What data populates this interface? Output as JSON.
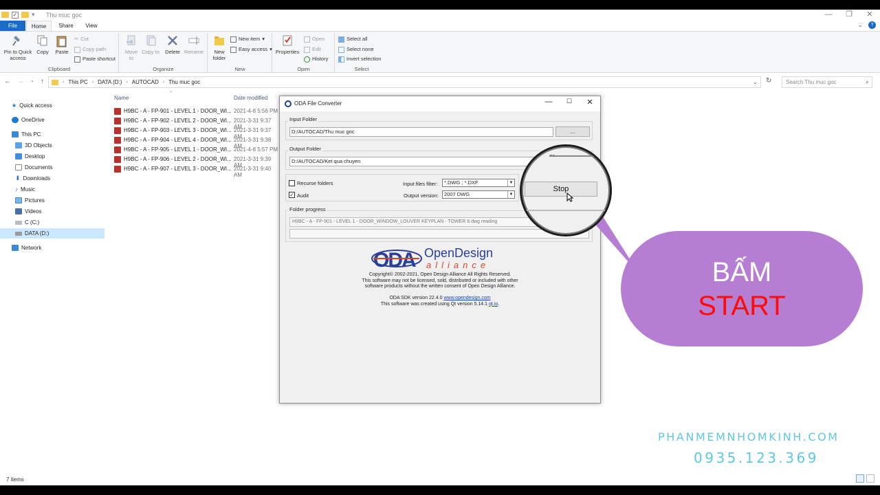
{
  "window": {
    "title": "Thu muc goc",
    "min": "—",
    "max": "❐",
    "close": "✕"
  },
  "ribbon_tabs": [
    "File",
    "Home",
    "Share",
    "View"
  ],
  "ribbon": {
    "clipboard": {
      "label": "Clipboard",
      "pin": "Pin to Quick access",
      "copy": "Copy",
      "paste": "Paste",
      "cut": "Cut",
      "copy_path": "Copy path",
      "paste_shortcut": "Paste shortcut"
    },
    "organize": {
      "label": "Organize",
      "move_to": "Move to",
      "copy_to": "Copy to",
      "delete": "Delete",
      "rename": "Rename"
    },
    "new": {
      "label": "New",
      "new_folder": "New folder",
      "new_item": "New item",
      "easy_access": "Easy access"
    },
    "open": {
      "label": "Open",
      "properties": "Properties",
      "open": "Open",
      "edit": "Edit",
      "history": "History"
    },
    "select": {
      "label": "Select",
      "select_all": "Select all",
      "select_none": "Select none",
      "invert": "Invert selection"
    }
  },
  "address": {
    "crumbs": [
      "This PC",
      "DATA (D:)",
      "AUTOCAD",
      "Thu muc goc"
    ],
    "search_placeholder": "Search Thu muc goc"
  },
  "nav": [
    {
      "label": "Quick access"
    },
    {
      "label": "OneDrive"
    },
    {
      "label": "This PC"
    },
    {
      "label": "3D Objects"
    },
    {
      "label": "Desktop"
    },
    {
      "label": "Documents"
    },
    {
      "label": "Downloads"
    },
    {
      "label": "Music"
    },
    {
      "label": "Pictures"
    },
    {
      "label": "Videos"
    },
    {
      "label": "C (C:)"
    },
    {
      "label": "DATA (D:)"
    },
    {
      "label": "Network"
    }
  ],
  "columns": {
    "name": "Name",
    "date": "Date modified"
  },
  "files": [
    {
      "name": "H9BC - A - FP-901 - LEVEL 1 - DOOR_WI...",
      "date": "2021-4-8 5:56 PM"
    },
    {
      "name": "H9BC - A - FP-902 - LEVEL 2 - DOOR_WI...",
      "date": "2021-3-31 9:37 AM"
    },
    {
      "name": "H9BC - A - FP-903 - LEVEL 3 - DOOR_WI...",
      "date": "2021-3-31 9:37 AM"
    },
    {
      "name": "H9BC - A - FP-904 - LEVEL 4 - DOOR_WI...",
      "date": "2021-3-31 9:38 AM"
    },
    {
      "name": "H9BC - A - FP-905 - LEVEL 1 - DOOR_WI...",
      "date": "2021-4-8 5:57 PM"
    },
    {
      "name": "H9BC - A - FP-906 - LEVEL 2 - DOOR_WI...",
      "date": "2021-3-31 9:39 AM"
    },
    {
      "name": "H9BC - A - FP-907 - LEVEL 3 - DOOR_WI...",
      "date": "2021-3-31 9:40 AM"
    }
  ],
  "status": "7 items",
  "dialog": {
    "title": "ODA File Converter",
    "input_folder_label": "Input Folder",
    "input_folder": "D:/AUTOCAD/Thu muc goc",
    "output_folder_label": "Output Folder",
    "output_folder": "D:/AUTOCAD/Ket qua chuyen",
    "browse": "...",
    "recurse": "Recurse folders",
    "recurse_checked": false,
    "audit": "Audit",
    "audit_checked": true,
    "filter_label": "Input files filter:",
    "filter_value": "*.DWG ; *.DXF",
    "version_label": "Output version:",
    "version_value": "2007 DWG",
    "stop": "Stop",
    "progress_label": "Folder progress",
    "progress_file": "H9BC - A - FP-901 - LEVEL 1 - DOOR_WINDOW_LOUVER KEYPLAN - TOWER 8.dwg reading",
    "brand_top": "OpenDesign",
    "brand_bottom": "alliance",
    "copyright": "Copyright© 2002-2021, Open Design Alliance All Rights Reserved.",
    "license1": "This software may not be licensed, sold, distributed or included with other",
    "license2": "software products without the written consent of Open Design Alliance.",
    "sdk_prefix": "ODA SDK version 22.4.0",
    "sdk_link": "www.opendesign.com",
    "qt_prefix": "This software was created using Qt version 5.14.1",
    "qt_link": "qt.io",
    "qt_suffix": "."
  },
  "overlay": {
    "line1": "BẤM",
    "line2": "START",
    "site": "PHANMEMNHOMKINH.COM",
    "phone": "0935.123.369"
  }
}
